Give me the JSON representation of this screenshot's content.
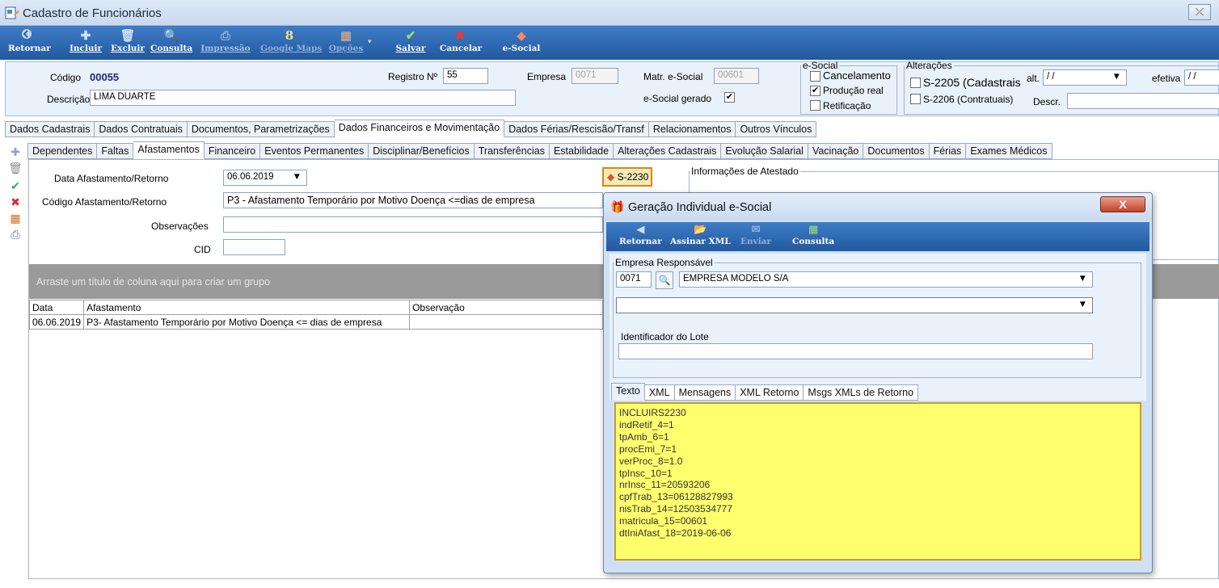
{
  "window": {
    "title": "Cadastro de Funcionários",
    "close_glyph": "⤫"
  },
  "toolbar": {
    "items": [
      {
        "label": "Retornar",
        "icon": "back-arrow-icon"
      },
      {
        "label": "Incluir",
        "icon": "plus-icon"
      },
      {
        "label": "Excluir",
        "icon": "trash-icon"
      },
      {
        "label": "Consulta",
        "icon": "magnifier-icon"
      },
      {
        "label": "Impressão",
        "icon": "printer-icon"
      },
      {
        "label": "Google Maps",
        "icon": "google-maps-icon"
      },
      {
        "label": "Opções",
        "icon": "options-grid-icon"
      },
      {
        "label": "Salvar",
        "icon": "checkmark-icon"
      },
      {
        "label": "Cancelar",
        "icon": "x-icon"
      },
      {
        "label": "e-Social",
        "icon": "esocial-icon"
      }
    ]
  },
  "header": {
    "codigo_label": "Código",
    "codigo_value": "00055",
    "registro_label": "Registro Nº",
    "registro_value": "55",
    "empresa_label": "Empresa",
    "empresa_value": "0071",
    "matr_label": "Matr. e-Social",
    "matr_value": "00601",
    "descricao_label": "Descrição",
    "descricao_value": "LIMA DUARTE",
    "esocial_gerado_label": "e-Social gerado",
    "esocial_gerado_checked": "✔",
    "esocial_group": {
      "legend": "e-Social",
      "cancelamento": "Cancelamento",
      "producao_real": "Produção real",
      "producao_checked": "✔",
      "retificacao": "Retificação"
    },
    "alteracoes_group": {
      "legend": "Alterações",
      "s2205": "S-2205 (Cadastrais",
      "s2206": "S-2206 (Contratuais)",
      "alt_label": "alt.",
      "alt_value": "/ /",
      "efetiva_label": "efetiva",
      "efetiva_value": "/ /",
      "descr_label": "Descr."
    }
  },
  "main_tabs": [
    "Dados Cadastrais",
    "Dados Contratuais",
    "Documentos, Parametrizações",
    "Dados Financeiros e Movimentação",
    "Dados Férias/Rescisão/Transf",
    "Relacionamentos",
    "Outros Vínculos"
  ],
  "sub_tabs": [
    "Dependentes",
    "Faltas",
    "Afastamentos",
    "Financeiro",
    "Eventos Permanentes",
    "Disciplinar/Benefícios",
    "Transferências",
    "Estabilidade",
    "Alterações Cadastrais",
    "Evolução Salarial",
    "Vacinação",
    "Documentos",
    "Férias",
    "Exames Médicos"
  ],
  "form": {
    "data_label": "Data Afastamento/Retorno",
    "data_value": "06.06.2019",
    "codigo_label": "Código Afastamento/Retorno",
    "codigo_value": "P3 - Afastamento Temporário por Motivo Doença <=dias de empresa",
    "obs_label": "Observações",
    "obs_value": "",
    "cid_label": "CID",
    "cid_value": "",
    "s2230_label": "S-2230",
    "atestado_legend": "Informações de Atestado"
  },
  "grid": {
    "group_hint": "Arraste um título de coluna aqui para criar um grupo",
    "columns": [
      "Data",
      "Afastamento",
      "Observação"
    ],
    "rows": [
      [
        "06.06.2019",
        "P3- Afastamento Temporário por Motivo Doença <= dias de empresa",
        ""
      ]
    ]
  },
  "dialog": {
    "title": "Geração Individual e-Social",
    "close_label": "X",
    "toolbar": [
      {
        "label": "Retornar",
        "icon": "back-arrow-icon"
      },
      {
        "label": "Assinar XML",
        "icon": "folder-sign-icon"
      },
      {
        "label": "Enviar",
        "icon": "send-icon"
      },
      {
        "label": "Consulta",
        "icon": "grid-search-icon"
      }
    ],
    "empresa_legend": "Empresa Responsável",
    "empresa_code": "0071",
    "empresa_name": "EMPRESA MODELO S/A",
    "second_select": "",
    "lote_label": "Identificador do Lote",
    "lote_value": "",
    "tabs": [
      "Texto",
      "XML",
      "Mensagens",
      "XML Retorno",
      "Msgs XMLs de Retorno"
    ],
    "text_lines": [
      "INCLUIRS2230",
      "indRetif_4=1",
      "tpAmb_6=1",
      "procEmi_7=1",
      "verProc_8=1.0",
      "tpInsc_10=1",
      "nrInsc_11=20593206",
      "cpfTrab_13=06128827993",
      "nisTrab_14=12503534777",
      "matricula_15=00601",
      "dtIniAfast_18=2019-06-06"
    ]
  },
  "colors": {
    "toolbar_blue": "#2f6db7",
    "panel_bg": "#e9f1fa",
    "yellow_text_area": "#ffff6e",
    "group_bar": "#9a9a9a"
  }
}
